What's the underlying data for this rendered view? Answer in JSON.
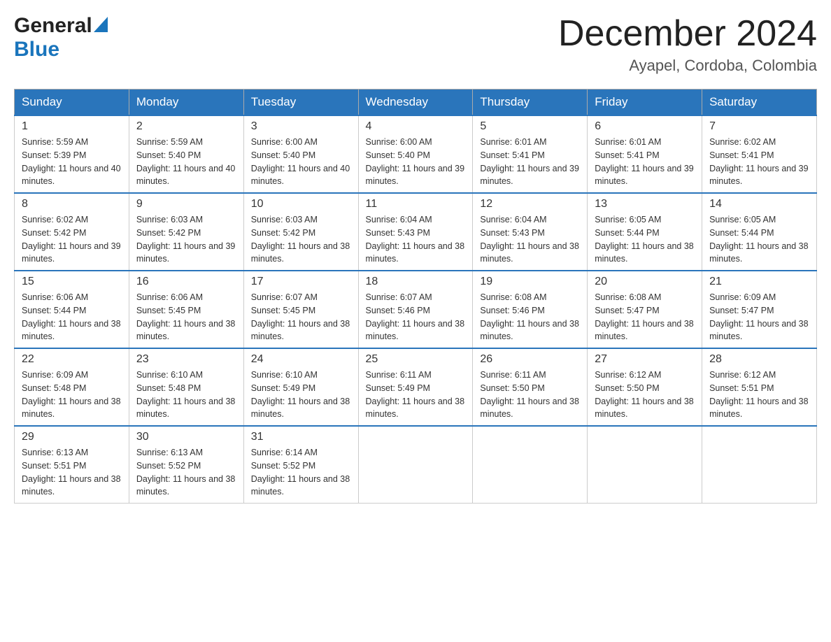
{
  "header": {
    "logo_general": "General",
    "logo_blue": "Blue",
    "month_year": "December 2024",
    "location": "Ayapel, Cordoba, Colombia"
  },
  "days_of_week": [
    "Sunday",
    "Monday",
    "Tuesday",
    "Wednesday",
    "Thursday",
    "Friday",
    "Saturday"
  ],
  "weeks": [
    [
      {
        "date": "1",
        "sunrise": "5:59 AM",
        "sunset": "5:39 PM",
        "daylight": "11 hours and 40 minutes."
      },
      {
        "date": "2",
        "sunrise": "5:59 AM",
        "sunset": "5:40 PM",
        "daylight": "11 hours and 40 minutes."
      },
      {
        "date": "3",
        "sunrise": "6:00 AM",
        "sunset": "5:40 PM",
        "daylight": "11 hours and 40 minutes."
      },
      {
        "date": "4",
        "sunrise": "6:00 AM",
        "sunset": "5:40 PM",
        "daylight": "11 hours and 39 minutes."
      },
      {
        "date": "5",
        "sunrise": "6:01 AM",
        "sunset": "5:41 PM",
        "daylight": "11 hours and 39 minutes."
      },
      {
        "date": "6",
        "sunrise": "6:01 AM",
        "sunset": "5:41 PM",
        "daylight": "11 hours and 39 minutes."
      },
      {
        "date": "7",
        "sunrise": "6:02 AM",
        "sunset": "5:41 PM",
        "daylight": "11 hours and 39 minutes."
      }
    ],
    [
      {
        "date": "8",
        "sunrise": "6:02 AM",
        "sunset": "5:42 PM",
        "daylight": "11 hours and 39 minutes."
      },
      {
        "date": "9",
        "sunrise": "6:03 AM",
        "sunset": "5:42 PM",
        "daylight": "11 hours and 39 minutes."
      },
      {
        "date": "10",
        "sunrise": "6:03 AM",
        "sunset": "5:42 PM",
        "daylight": "11 hours and 38 minutes."
      },
      {
        "date": "11",
        "sunrise": "6:04 AM",
        "sunset": "5:43 PM",
        "daylight": "11 hours and 38 minutes."
      },
      {
        "date": "12",
        "sunrise": "6:04 AM",
        "sunset": "5:43 PM",
        "daylight": "11 hours and 38 minutes."
      },
      {
        "date": "13",
        "sunrise": "6:05 AM",
        "sunset": "5:44 PM",
        "daylight": "11 hours and 38 minutes."
      },
      {
        "date": "14",
        "sunrise": "6:05 AM",
        "sunset": "5:44 PM",
        "daylight": "11 hours and 38 minutes."
      }
    ],
    [
      {
        "date": "15",
        "sunrise": "6:06 AM",
        "sunset": "5:44 PM",
        "daylight": "11 hours and 38 minutes."
      },
      {
        "date": "16",
        "sunrise": "6:06 AM",
        "sunset": "5:45 PM",
        "daylight": "11 hours and 38 minutes."
      },
      {
        "date": "17",
        "sunrise": "6:07 AM",
        "sunset": "5:45 PM",
        "daylight": "11 hours and 38 minutes."
      },
      {
        "date": "18",
        "sunrise": "6:07 AM",
        "sunset": "5:46 PM",
        "daylight": "11 hours and 38 minutes."
      },
      {
        "date": "19",
        "sunrise": "6:08 AM",
        "sunset": "5:46 PM",
        "daylight": "11 hours and 38 minutes."
      },
      {
        "date": "20",
        "sunrise": "6:08 AM",
        "sunset": "5:47 PM",
        "daylight": "11 hours and 38 minutes."
      },
      {
        "date": "21",
        "sunrise": "6:09 AM",
        "sunset": "5:47 PM",
        "daylight": "11 hours and 38 minutes."
      }
    ],
    [
      {
        "date": "22",
        "sunrise": "6:09 AM",
        "sunset": "5:48 PM",
        "daylight": "11 hours and 38 minutes."
      },
      {
        "date": "23",
        "sunrise": "6:10 AM",
        "sunset": "5:48 PM",
        "daylight": "11 hours and 38 minutes."
      },
      {
        "date": "24",
        "sunrise": "6:10 AM",
        "sunset": "5:49 PM",
        "daylight": "11 hours and 38 minutes."
      },
      {
        "date": "25",
        "sunrise": "6:11 AM",
        "sunset": "5:49 PM",
        "daylight": "11 hours and 38 minutes."
      },
      {
        "date": "26",
        "sunrise": "6:11 AM",
        "sunset": "5:50 PM",
        "daylight": "11 hours and 38 minutes."
      },
      {
        "date": "27",
        "sunrise": "6:12 AM",
        "sunset": "5:50 PM",
        "daylight": "11 hours and 38 minutes."
      },
      {
        "date": "28",
        "sunrise": "6:12 AM",
        "sunset": "5:51 PM",
        "daylight": "11 hours and 38 minutes."
      }
    ],
    [
      {
        "date": "29",
        "sunrise": "6:13 AM",
        "sunset": "5:51 PM",
        "daylight": "11 hours and 38 minutes."
      },
      {
        "date": "30",
        "sunrise": "6:13 AM",
        "sunset": "5:52 PM",
        "daylight": "11 hours and 38 minutes."
      },
      {
        "date": "31",
        "sunrise": "6:14 AM",
        "sunset": "5:52 PM",
        "daylight": "11 hours and 38 minutes."
      },
      null,
      null,
      null,
      null
    ]
  ],
  "labels": {
    "sunrise_prefix": "Sunrise: ",
    "sunset_prefix": "Sunset: ",
    "daylight_prefix": "Daylight: "
  }
}
